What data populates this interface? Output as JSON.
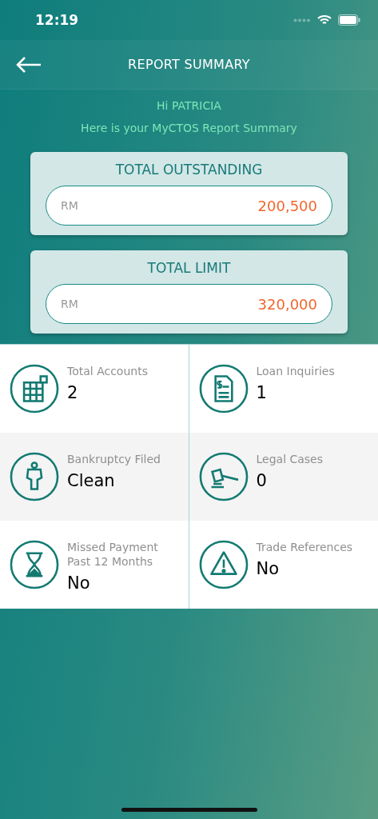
{
  "status_bar": {
    "time": "12:19"
  },
  "header": {
    "title": "REPORT SUMMARY"
  },
  "greeting": {
    "name_line": "Hi PATRICIA",
    "subtitle": "Here is your MyCTOS Report Summary"
  },
  "totals": [
    {
      "title": "TOTAL OUTSTANDING",
      "currency": "RM",
      "amount": "200,500"
    },
    {
      "title": "TOTAL LIMIT",
      "currency": "RM",
      "amount": "320,000"
    }
  ],
  "stats": [
    {
      "kind": "accounts",
      "label": "Total Accounts",
      "value": "2"
    },
    {
      "kind": "inquiries",
      "label": "Loan Inquiries",
      "value": "1"
    },
    {
      "kind": "bankruptcy",
      "label": "Bankruptcy Filed",
      "value": "Clean"
    },
    {
      "kind": "legal",
      "label": "Legal Cases",
      "value": "0"
    },
    {
      "kind": "missed",
      "label": "Missed Payment Past 12 Months",
      "value": "No"
    },
    {
      "kind": "warning",
      "label": "Trade References",
      "value": "No"
    }
  ]
}
